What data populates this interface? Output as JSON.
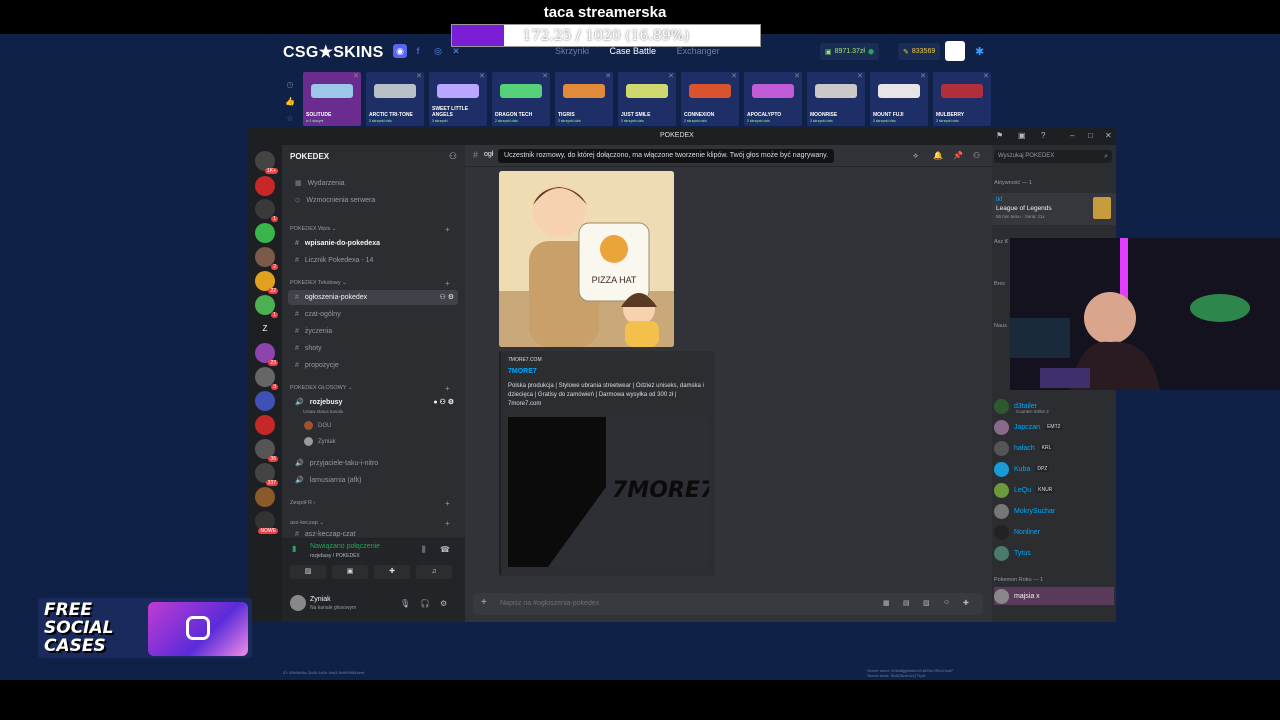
{
  "overlay": {
    "title": "taca streamerska",
    "progress_text": "172.25 / 1020 (16.89%)",
    "progress_fraction": 0.1689
  },
  "site": {
    "logo": "CSG★SKINS",
    "nav": [
      "Skrzynki",
      "Case Battle",
      "Exchanger"
    ],
    "balance": "8971.37zł",
    "coins": "833569",
    "cases": [
      {
        "name": "SOLITUDE",
        "sub": "w 1 skrzyni",
        "color": "#9bc7e8"
      },
      {
        "name": "ARCTIC TRI-TONE",
        "sub": "2 skrzynki dzis",
        "color": "#b8c0c8"
      },
      {
        "name": "SWEET LITTLE ANGELS",
        "sub": "3 skrzynki",
        "color": "#b8a6ff"
      },
      {
        "name": "DRAGON TECH",
        "sub": "2 skrzynki dzis",
        "color": "#55d17a"
      },
      {
        "name": "TIGRIS",
        "sub": "2 skrzynki dzis",
        "color": "#e08a3a"
      },
      {
        "name": "JUST SMILE",
        "sub": "2 skrzynki dzis",
        "color": "#cfd86e"
      },
      {
        "name": "CONNEXION",
        "sub": "2 skrzynki dzis",
        "color": "#d9542e"
      },
      {
        "name": "APOCALYPTO",
        "sub": "2 skrzynki dzis",
        "color": "#c25bd6"
      },
      {
        "name": "MOONRISE",
        "sub": "2 skrzynki dzis",
        "color": "#c9c9c9"
      },
      {
        "name": "MOUNT FUJI",
        "sub": "2 skrzynki dzis",
        "color": "#e6e6e6"
      },
      {
        "name": "MULBERRY",
        "sub": "2 skrzynki dzis",
        "color": "#b02f3b"
      }
    ]
  },
  "discord": {
    "window_title": "POKEDEX",
    "server_name": "POKEDEX",
    "top_items": [
      "Wydarzenia",
      "Wzmocnienia serwera"
    ],
    "cat1": "POKEDEX Wpis",
    "cat1_channels": [
      "wpisanie-do-pokedexa",
      "Licznik Pokedexa - 14"
    ],
    "cat2": "POKEDEX Tekstowy",
    "cat2_channels": [
      "ogłoszenia-pokedex",
      "czat-ogólny",
      "życzenia",
      "shoty",
      "propozycje"
    ],
    "cat3": "POKEDEX GŁOSOWY",
    "voice_channel": "rozjebusy",
    "voice_status": "Ustaw status kanału",
    "voice_users": [
      "DGU",
      "Zyniak"
    ],
    "voice_channels_more": [
      "przyjaciele-taku-i-nitro",
      "lamusiarnia (afk)"
    ],
    "cat4": "Zespół R",
    "cat5": "asz-keczap",
    "cat5_channel": "asz-keczap-czat",
    "voice_connected": "Nawiązano połączenie",
    "voice_connected_sub": "rozjebusy / POKEDEX",
    "user_name": "Zyniak",
    "user_status": "Na kanale głosowym",
    "current_channel": "ogł",
    "tooltip": "Uczestnik rozmowy, do której dołączono, ma włączone tworzenie klipów. Twój głos może być nagrywany.",
    "search_placeholder": "Wyszukaj POKEDEX",
    "image_caption": "PIZZA HAT",
    "embed": {
      "site": "7MORE7.COM",
      "title": "7MORE7",
      "description": "Polska produkcja | Stylowe ubrania streetwear | Odzież uniseks, damska i dziecięca | Gratisy do zamówień | Darmowa wysyłka od 300 zł | 7more7.com",
      "logo_text": "7MORE7"
    },
    "input_placeholder": "Napisz na #ogłoszenia-pokedex",
    "members": {
      "activity_header": "Aktywność — 1",
      "activity_user": "tkf",
      "activity_game": "League of Legends",
      "activity_detail": "55 min temu · Seria: 11x",
      "groups": [
        "Asz K",
        "Broc",
        "Naus"
      ],
      "list": [
        {
          "name": "d3tailer",
          "sub": "Counter-Strike 2",
          "color": "#00a8fc",
          "badge": ""
        },
        {
          "name": "Japczan",
          "sub": "",
          "color": "#00a8fc",
          "badge": "EMT2"
        },
        {
          "name": "hałach",
          "sub": "",
          "color": "#00a8fc",
          "badge": "KRL"
        },
        {
          "name": "Kuba",
          "sub": "",
          "color": "#00a8fc",
          "badge": "DPZ"
        },
        {
          "name": "LeQu",
          "sub": "",
          "color": "#00a8fc",
          "badge": "KNUR"
        },
        {
          "name": "MokrySuchar",
          "sub": "",
          "color": "#00a8fc",
          "badge": ""
        },
        {
          "name": "Nonliner",
          "sub": "",
          "color": "#00a8fc",
          "badge": ""
        },
        {
          "name": "Tytus",
          "sub": "",
          "color": "#00a8fc",
          "badge": ""
        }
      ],
      "footer_header": "Pokemon Roku — 1",
      "footer_user": "majsia x"
    }
  },
  "promo": {
    "line1": "FREE",
    "line2": "SOCIAL",
    "line3": "CASES"
  },
  "footer": {
    "left": "ID: 85b9b6bc-2b40-4d2e-9ea3-9c99998d4eef",
    "right1": "Server seed: 4Xfzb8jg5e8sVrZnB3Ss7ffDd7Aaf7",
    "right2": "Secret seed: Se6Z4kxtr4zQ74pA"
  }
}
